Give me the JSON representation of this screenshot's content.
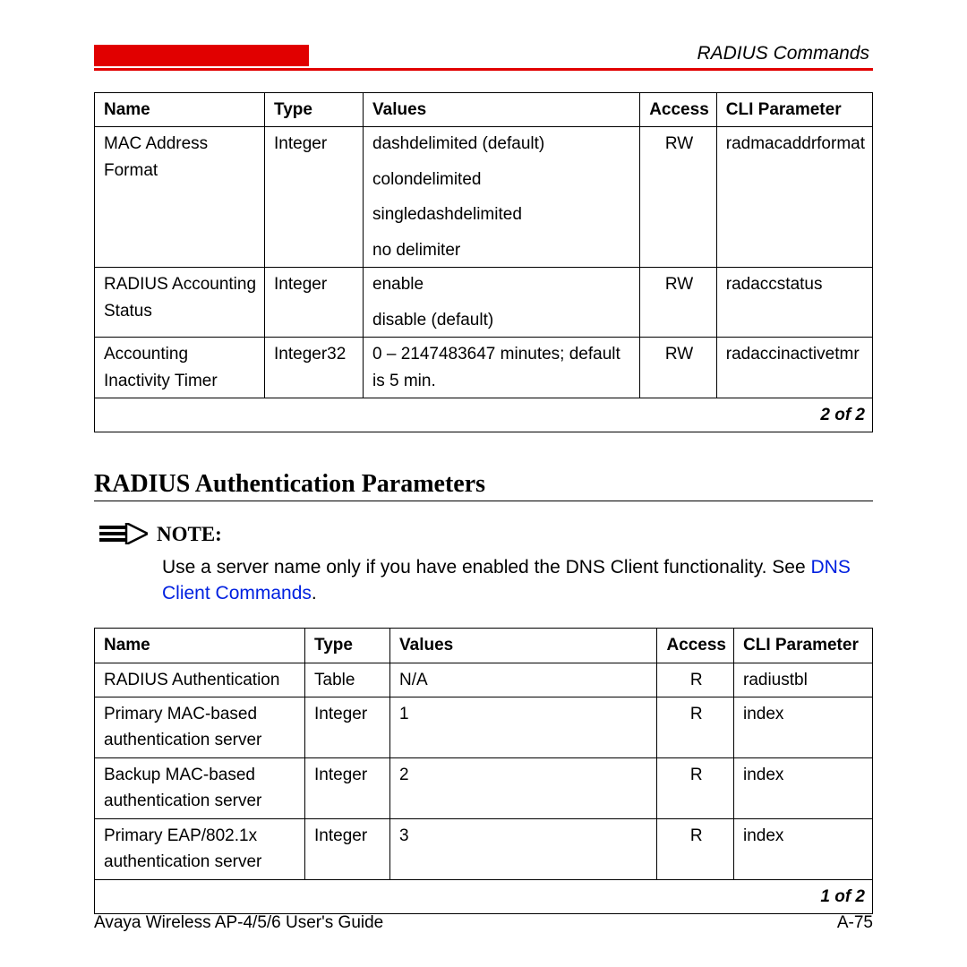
{
  "header": {
    "section": "RADIUS Commands"
  },
  "table1": {
    "headers": {
      "name": "Name",
      "type": "Type",
      "values": "Values",
      "access": "Access",
      "cli": "CLI Parameter"
    },
    "rows": [
      {
        "name": "MAC Address Format",
        "type": "Integer",
        "values": [
          "dashdelimited (default)",
          "colondelimited",
          "singledashdelimited",
          "no delimiter"
        ],
        "access": "RW",
        "cli": "radmacaddrformat"
      },
      {
        "name": "RADIUS Accounting Status",
        "type": "Integer",
        "values": [
          "enable",
          "disable (default)"
        ],
        "access": "RW",
        "cli": "radaccstatus"
      },
      {
        "name": "Accounting Inactivity Timer",
        "type": "Integer32",
        "values": [
          "0 – 2147483647 minutes; default is 5 min."
        ],
        "access": "RW",
        "cli": "radaccinactivetmr"
      }
    ],
    "pager": "2 of 2"
  },
  "section": {
    "title": "RADIUS Authentication Parameters"
  },
  "note": {
    "label": "NOTE:",
    "text_before": "Use a server name only if you have enabled the DNS Client functionality. See ",
    "link": "DNS Client Commands",
    "text_after": "."
  },
  "table2": {
    "headers": {
      "name": "Name",
      "type": "Type",
      "values": "Values",
      "access": "Access",
      "cli": "CLI Parameter"
    },
    "rows": [
      {
        "name": "RADIUS Authentication",
        "type": "Table",
        "values": "N/A",
        "access": "R",
        "cli": "radiustbl"
      },
      {
        "name": "Primary MAC-based authentication server",
        "type": "Integer",
        "values": "1",
        "access": "R",
        "cli": "index"
      },
      {
        "name": "Backup MAC-based authentication server",
        "type": "Integer",
        "values": "2",
        "access": "R",
        "cli": "index"
      },
      {
        "name": "Primary EAP/802.1x authentication server",
        "type": "Integer",
        "values": "3",
        "access": "R",
        "cli": "index"
      }
    ],
    "pager": "1 of 2"
  },
  "footer": {
    "guide": "Avaya Wireless AP-4/5/6 User's Guide",
    "page": "A-75"
  }
}
